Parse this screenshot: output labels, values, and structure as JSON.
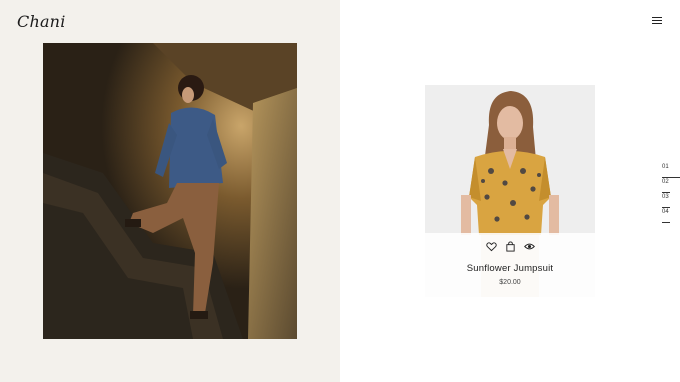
{
  "brand": {
    "logo_text": "Chani"
  },
  "header": {
    "menu_icon": "hamburger-menu-icon"
  },
  "hero": {
    "image_alt": "Model in denim jacket standing on stairs"
  },
  "product": {
    "name": "Sunflower Jumpsuit",
    "price": "$20.00",
    "actions": [
      "wishlist-heart-icon",
      "add-to-cart-bag-icon",
      "quick-view-eye-icon"
    ]
  },
  "pagination": {
    "pages": [
      "01",
      "02",
      "03",
      "04"
    ],
    "active_index": 0
  },
  "colors": {
    "left_panel_bg": "#f3f1ec",
    "page_bg": "#ffffff",
    "text": "#222222"
  }
}
